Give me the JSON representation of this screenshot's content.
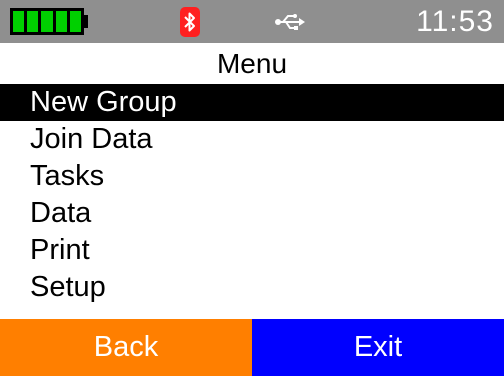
{
  "status_bar": {
    "battery_level": 1.0,
    "bluetooth_icon": "bluetooth-icon",
    "usb_icon": "usb-icon",
    "time": "11:53",
    "colors": {
      "background": "#8f8f8f",
      "battery_fill": "#00d000",
      "bluetooth_badge": "#ff2020"
    }
  },
  "menu": {
    "title": "Menu",
    "items": [
      {
        "label": "New Group",
        "selected": true
      },
      {
        "label": "Join Data",
        "selected": false
      },
      {
        "label": "Tasks",
        "selected": false
      },
      {
        "label": "Data",
        "selected": false
      },
      {
        "label": "Print",
        "selected": false
      },
      {
        "label": "Setup",
        "selected": false
      }
    ]
  },
  "softkeys": {
    "left": {
      "label": "Back",
      "color": "#ff7f00"
    },
    "right": {
      "label": "Exit",
      "color": "#0000ff"
    }
  }
}
